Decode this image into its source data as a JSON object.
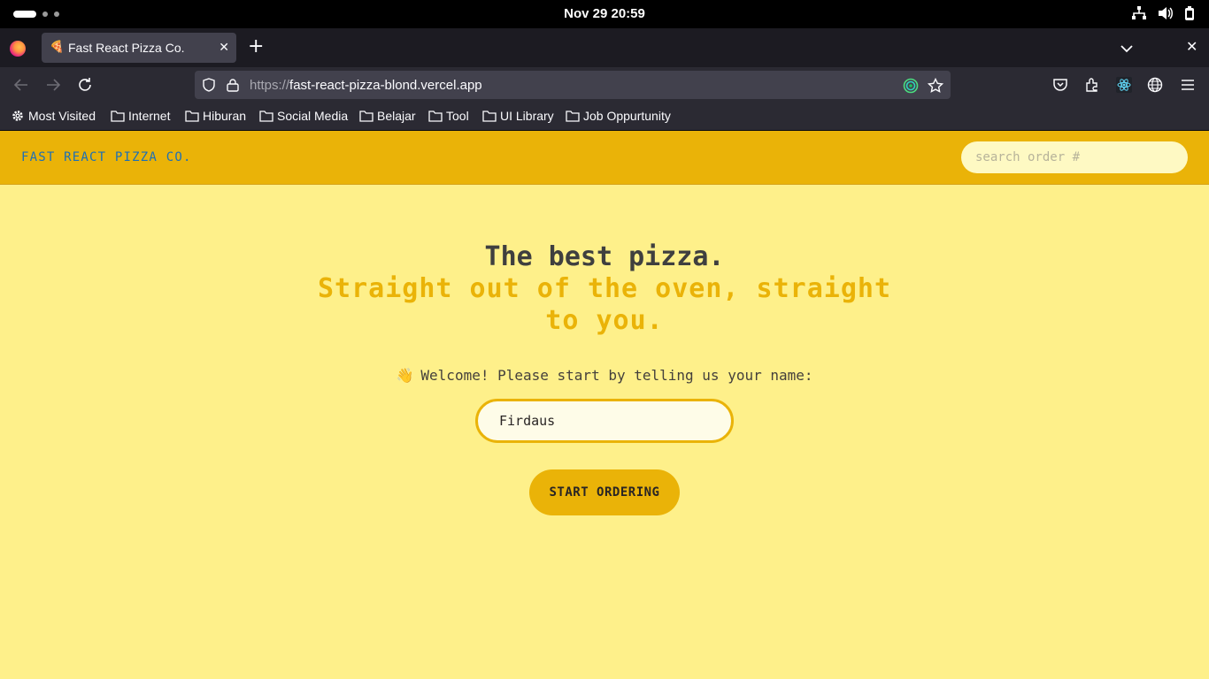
{
  "system_bar": {
    "clock": "Nov 29  20:59"
  },
  "browser": {
    "tab": {
      "title": "Fast React Pizza Co.",
      "favicon": "🍕",
      "close": "✕"
    },
    "new_tab": "+",
    "window_close": "✕",
    "url": {
      "scheme": "https://",
      "host": "fast-react-pizza-blond.vercel.app"
    },
    "bookmarks": [
      {
        "label": "Most Visited",
        "icon": "gear-icon"
      },
      {
        "label": "Internet",
        "icon": "folder-icon"
      },
      {
        "label": "Hiburan",
        "icon": "folder-icon"
      },
      {
        "label": "Social Media",
        "icon": "folder-icon"
      },
      {
        "label": "Belajar",
        "icon": "folder-icon"
      },
      {
        "label": "Tool",
        "icon": "folder-icon"
      },
      {
        "label": "UI Library",
        "icon": "folder-icon"
      },
      {
        "label": "Job Oppurtunity",
        "icon": "folder-icon"
      }
    ]
  },
  "page": {
    "header": {
      "logo": "FAST REACT PIZZA CO.",
      "search_placeholder": "search order #"
    },
    "hero": {
      "line1": "The best pizza.",
      "line2": "Straight out of the oven, straight to you."
    },
    "welcome": {
      "emoji": "👋",
      "text": "Welcome! Please start by telling us your name:"
    },
    "name_input": {
      "value": "Firdaus"
    },
    "start_button": "START ORDERING"
  },
  "colors": {
    "header_bg": "#eab308",
    "page_bg": "#fef08a",
    "logo": "#1c6fb6",
    "heading_dark": "#3f3f3f",
    "heading_accent": "#eab308"
  }
}
